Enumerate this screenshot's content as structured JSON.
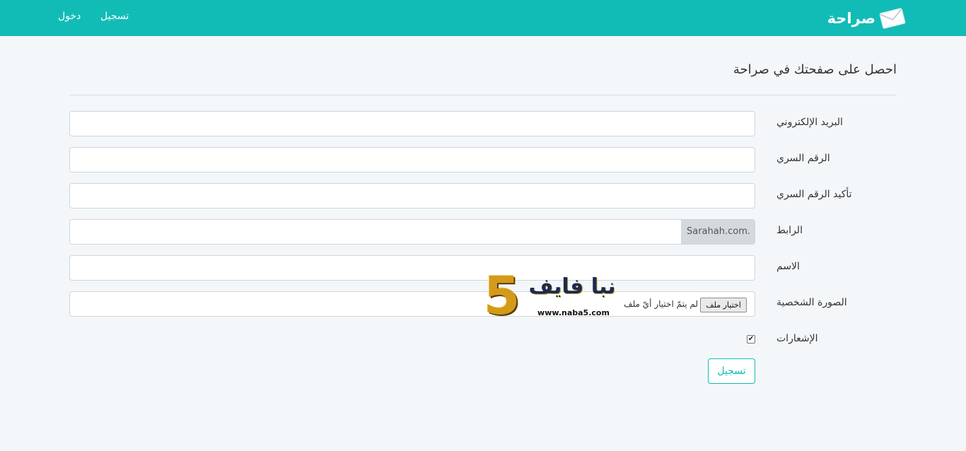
{
  "navbar": {
    "brand": "صراحة",
    "register_link": "تسجيل",
    "login_link": "دخول",
    "brand_color": "#12bcb6"
  },
  "page": {
    "title": "احصل على صفحتك في صراحة"
  },
  "form": {
    "email_label": "البريد الإلكتروني",
    "email_value": "",
    "password_label": "الرقم السري",
    "password_value": "",
    "confirm_password_label": "تأكيد الرقم السري",
    "confirm_password_value": "",
    "link_label": "الرابط",
    "link_addon": "Sarahah.com.",
    "link_value": "",
    "name_label": "الاسم",
    "name_value": "",
    "photo_label": "الصورة الشخصية",
    "photo_button": "اختيار ملف",
    "photo_status": "لم يتمّ اختيار أيّ ملف",
    "notifications_label": "الإشعارات",
    "notifications_checked": true,
    "notifications_mark": "✔",
    "submit_label": "تسجيل"
  },
  "watermark": {
    "digit": "5",
    "arabic": "نبا فايف",
    "url": "www.naba5.com"
  },
  "icons": {
    "brand_icon": "envelope-icon"
  }
}
